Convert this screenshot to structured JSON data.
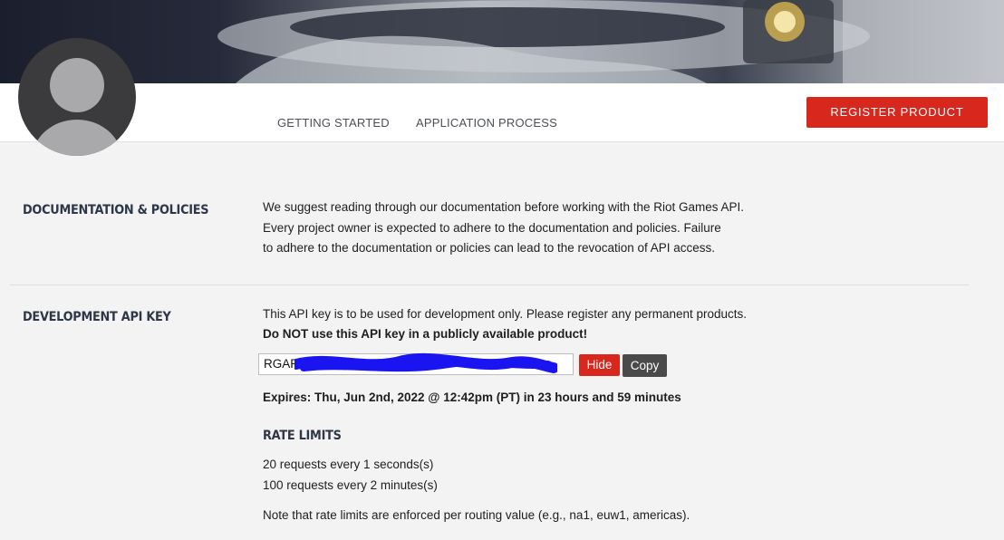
{
  "nav": {
    "getting_started": "GETTING STARTED",
    "application_process": "APPLICATION PROCESS",
    "register_product": "REGISTER PRODUCT"
  },
  "documentation": {
    "title": "DOCUMENTATION & POLICIES",
    "lines": [
      "We suggest reading through our documentation before working with the Riot Games API.",
      "Every project owner is expected to adhere to the documentation and policies. Failure",
      "to adhere to the documentation or policies can lead to the revocation of API access."
    ]
  },
  "dev_key": {
    "title": "DEVELOPMENT API KEY",
    "notice": "This API key is to be used for development only. Please register any permanent products.",
    "warning": "Do NOT use this API key in a publicly available product!",
    "key_value": "RGAPI",
    "hide_label": "Hide",
    "copy_label": "Copy",
    "expires": "Expires: Thu, Jun 2nd, 2022 @ 12:42pm (PT) in 23 hours and 59 minutes"
  },
  "rate_limits": {
    "title": "RATE LIMITS",
    "limits": [
      "20 requests every 1 seconds(s)",
      "100 requests every 2 minutes(s)"
    ],
    "note": "Note that rate limits are enforced per routing value (e.g., na1, euw1, americas)."
  },
  "colors": {
    "accent_red": "#d8281e",
    "copy_button": "#4a4a4a",
    "redaction": "#1a14f0"
  }
}
